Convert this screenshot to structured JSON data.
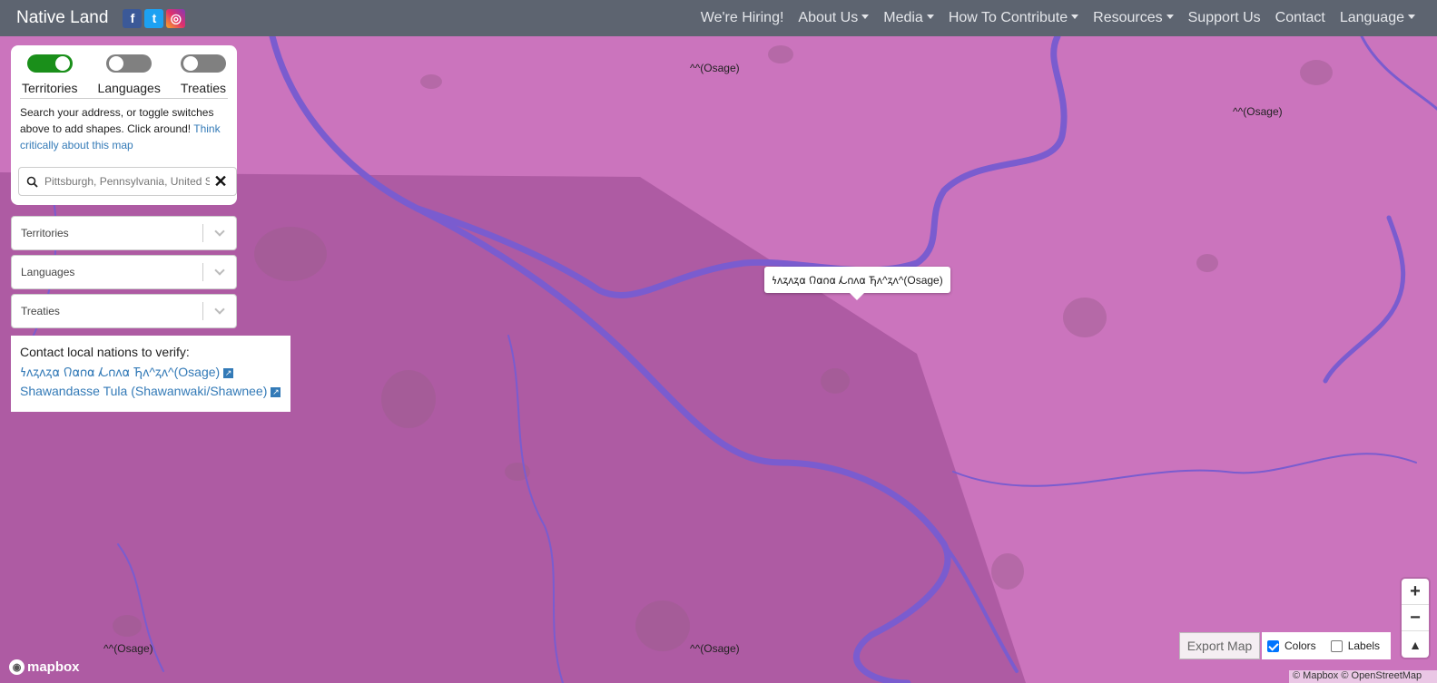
{
  "navbar": {
    "brand": "Native Land",
    "social": [
      {
        "name": "facebook-icon",
        "glyph": "f"
      },
      {
        "name": "twitter-icon",
        "glyph": "t"
      },
      {
        "name": "instagram-icon",
        "glyph": "◎"
      }
    ],
    "items": [
      {
        "label": "We're Hiring!",
        "dropdown": false
      },
      {
        "label": "About Us",
        "dropdown": true
      },
      {
        "label": "Media",
        "dropdown": true
      },
      {
        "label": "How To Contribute",
        "dropdown": true
      },
      {
        "label": "Resources",
        "dropdown": true
      },
      {
        "label": "Support Us",
        "dropdown": false
      },
      {
        "label": "Contact",
        "dropdown": false
      },
      {
        "label": "Language",
        "dropdown": true
      }
    ]
  },
  "panel": {
    "toggles": [
      {
        "label": "Territories",
        "on": true
      },
      {
        "label": "Languages",
        "on": false
      },
      {
        "label": "Treaties",
        "on": false
      }
    ],
    "help_text": "Search your address, or toggle switches above to add shapes. Click around!",
    "help_link": "Think critically about this map",
    "search": {
      "placeholder": "Pittsburgh, Pennsylvania, United States",
      "clear_label": "✕"
    }
  },
  "dropdowns": {
    "territories": "Territories",
    "languages": "Languages",
    "treaties": "Treaties"
  },
  "contact": {
    "title": "Contact local nations to verify:",
    "links": [
      "𐓏𐓘𐓻𐓘𐓻𐓟 𐒻𐓟𐓣𐓟 𐓁𐓣𐓘𐓟 𐓍𐓘^𐓻𐓘^(Osage)",
      "Shawandasse Tula (Shawanwaki/Shawnee)"
    ]
  },
  "map": {
    "labels": [
      {
        "text": "^^(Osage)"
      },
      {
        "text": "^^(Osage)"
      },
      {
        "text": "^^(Osage)"
      },
      {
        "text": "^^(Osage)"
      }
    ],
    "popup": "𐓏𐓘𐓻𐓘𐓻𐓟 𐒻𐓟𐓣𐓟 𐓁𐓣𐓘𐓟 𐓍𐓘^𐓻𐓘^(Osage)",
    "colors": {
      "territory_light": "#cb74bd",
      "territory_dark": "#a9579f",
      "river": "#7a5ccf"
    }
  },
  "controls": {
    "mapbox_label": "mapbox",
    "zoom_in": "+",
    "zoom_out": "−",
    "compass": "▲",
    "export_label": "Export Map",
    "colors_label": "Colors",
    "colors_checked": true,
    "labels_label": "Labels",
    "labels_checked": false,
    "attribution": "© Mapbox © OpenStreetMap"
  }
}
